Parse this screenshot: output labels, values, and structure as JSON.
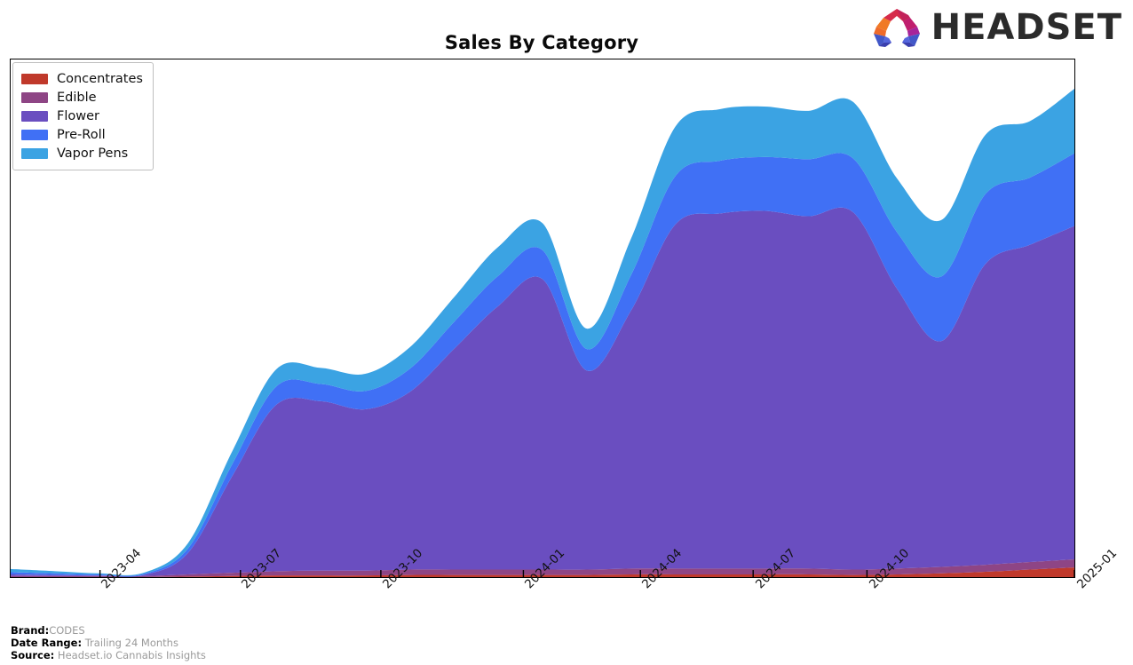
{
  "header": {
    "title": "Sales By Category",
    "logo_text": "HEADSET",
    "logo_icon": "headset-arch-logo"
  },
  "legend": {
    "items": [
      {
        "label": "Concentrates",
        "color": "#c0392b"
      },
      {
        "label": "Edible",
        "color": "#8e4585"
      },
      {
        "label": "Flower",
        "color": "#6a4ec0"
      },
      {
        "label": "Pre-Roll",
        "color": "#4070f5"
      },
      {
        "label": "Vapor Pens",
        "color": "#3ba3e3"
      }
    ]
  },
  "footer": {
    "brand_label": "Brand:",
    "brand_value": "CODES",
    "date_range_label": "Date Range:",
    "date_range_value": "Trailing 24 Months",
    "source_label": "Source:",
    "source_value": "Headset.io Cannabis Insights"
  },
  "chart_data": {
    "type": "area",
    "stacked": true,
    "title": "Sales By Category",
    "xlabel": "",
    "ylabel": "",
    "grid": false,
    "legend_position": "top-left",
    "axis_ticks": [
      "2023-04",
      "2023-07",
      "2023-10",
      "2024-01",
      "2024-04",
      "2024-07",
      "2024-10",
      "2025-01"
    ],
    "tick_positions_pct": [
      8.4,
      21.6,
      34.8,
      48.2,
      59.2,
      69.8,
      80.5,
      100.0
    ],
    "x": [
      "2023-01",
      "2023-02",
      "2023-03",
      "2023-04",
      "2023-05",
      "2023-06",
      "2023-07",
      "2023-08",
      "2023-09",
      "2023-10",
      "2023-11",
      "2023-12",
      "2024-01",
      "2024-02",
      "2024-03",
      "2024-04",
      "2024-05",
      "2024-06",
      "2024-07",
      "2024-08",
      "2024-09",
      "2024-10",
      "2024-11",
      "2024-12",
      "2025-01"
    ],
    "ylim": [
      0,
      100
    ],
    "series": [
      {
        "name": "Concentrates",
        "color": "#c0392b",
        "values": [
          0.0,
          0.0,
          0.0,
          0.0,
          0.1,
          0.2,
          0.3,
          0.3,
          0.3,
          0.4,
          0.4,
          0.4,
          0.4,
          0.4,
          0.5,
          0.5,
          0.5,
          0.5,
          0.5,
          0.4,
          0.5,
          0.7,
          1.0,
          1.4,
          1.8
        ]
      },
      {
        "name": "Edible",
        "color": "#8e4585",
        "values": [
          0.2,
          0.2,
          0.2,
          0.2,
          0.4,
          0.6,
          0.8,
          0.9,
          0.9,
          1.0,
          1.0,
          1.0,
          1.0,
          1.0,
          1.1,
          1.1,
          1.1,
          1.1,
          1.1,
          1.0,
          1.1,
          1.2,
          1.3,
          1.4,
          1.5
        ]
      },
      {
        "name": "Flower",
        "color": "#6a4ec0",
        "values": [
          0.3,
          0.2,
          0.1,
          0.2,
          4.0,
          18.0,
          31.0,
          31.5,
          30.0,
          33.0,
          41.0,
          49.0,
          54.0,
          37.0,
          48.0,
          64.0,
          66.0,
          66.5,
          65.5,
          66.5,
          52.0,
          42.0,
          56.0,
          59.0,
          62.0
        ]
      },
      {
        "name": "Pre-Roll",
        "color": "#4070f5",
        "values": [
          0.4,
          0.3,
          0.2,
          0.2,
          0.8,
          2.2,
          3.4,
          3.2,
          3.4,
          4.3,
          5.0,
          5.6,
          5.4,
          4.0,
          6.6,
          9.0,
          9.8,
          10.0,
          10.6,
          10.0,
          10.5,
          12.0,
          13.0,
          12.5,
          13.5
        ]
      },
      {
        "name": "Vapor Pens",
        "color": "#3ba3e3",
        "values": [
          0.6,
          0.4,
          0.2,
          0.2,
          1.0,
          2.4,
          3.2,
          3.0,
          3.2,
          4.0,
          4.6,
          5.4,
          5.0,
          3.8,
          6.8,
          9.2,
          9.6,
          9.4,
          9.0,
          10.5,
          10.0,
          10.5,
          11.0,
          10.5,
          12.0
        ]
      }
    ]
  }
}
